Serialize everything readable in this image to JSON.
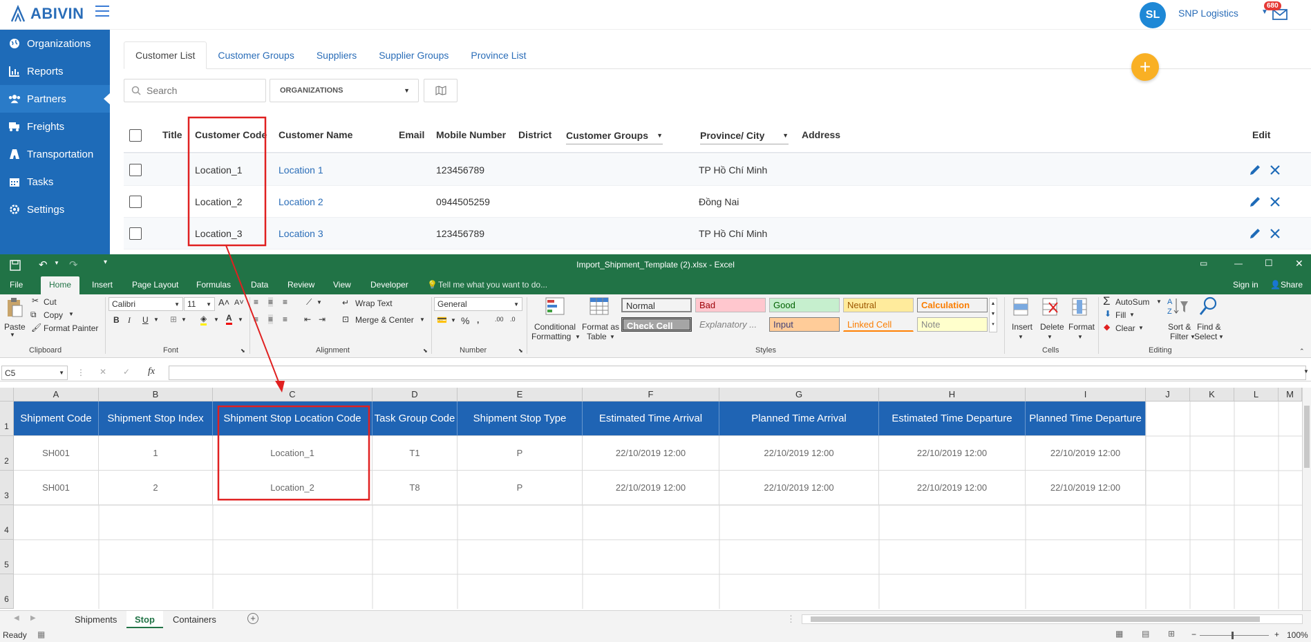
{
  "app": {
    "logo_text": "ABIVIN",
    "avatar_initials": "SL",
    "company": "SNP Logistics",
    "notification_count": "680",
    "brand_color": "#1e6bb8",
    "sidebar": [
      {
        "label": "Organizations",
        "icon": "globe-icon"
      },
      {
        "label": "Reports",
        "icon": "bar-chart-icon"
      },
      {
        "label": "Partners",
        "icon": "users-icon",
        "active": true
      },
      {
        "label": "Freights",
        "icon": "truck-icon"
      },
      {
        "label": "Transportation",
        "icon": "road-icon"
      },
      {
        "label": "Tasks",
        "icon": "calendar-icon"
      },
      {
        "label": "Settings",
        "icon": "gear-icon"
      }
    ],
    "tabs": [
      "Customer List",
      "Customer Groups",
      "Suppliers",
      "Supplier Groups",
      "Province List"
    ],
    "search_placeholder": "Search",
    "org_select": "ORGANIZATIONS",
    "columns": {
      "title": "Title",
      "customer_code": "Customer Code",
      "customer_name": "Customer Name",
      "email": "Email",
      "mobile": "Mobile Number",
      "district": "District",
      "customer_groups": "Customer Groups",
      "province": "Province/ City",
      "address": "Address",
      "edit": "Edit"
    },
    "rows": [
      {
        "code": "Location_1",
        "name": "Location 1",
        "mobile": "123456789",
        "province": "TP Hồ Chí Minh"
      },
      {
        "code": "Location_2",
        "name": "Location 2",
        "mobile": "0944505259",
        "province": "Đồng Nai"
      },
      {
        "code": "Location_3",
        "name": "Location 3",
        "mobile": "123456789",
        "province": "TP Hồ Chí Minh"
      }
    ]
  },
  "excel": {
    "title": "Import_Shipment_Template (2).xlsx - Excel",
    "accent": "#217346",
    "menu": [
      "File",
      "Home",
      "Insert",
      "Page Layout",
      "Formulas",
      "Data",
      "Review",
      "View",
      "Developer"
    ],
    "tell_me": "Tell me what you want to do...",
    "sign_in": "Sign in",
    "share": "Share",
    "ribbon": {
      "paste": "Paste",
      "cut": "Cut",
      "copy": "Copy",
      "format_painter": "Format Painter",
      "clipboard": "Clipboard",
      "font_name": "Calibri",
      "font_size": "11",
      "font": "Font",
      "wrap_text": "Wrap Text",
      "merge_center": "Merge & Center",
      "alignment": "Alignment",
      "number_format": "General",
      "number": "Number",
      "conditional": "Conditional",
      "formatting": "Formatting",
      "format_as": "Format as",
      "table": "Table",
      "styles_label": "Styles",
      "styles": [
        {
          "label": "Normal",
          "bg": "#ffffff",
          "fg": "#888888"
        },
        {
          "label": "Bad",
          "bg": "#ffc7ce",
          "fg": "#9c0006"
        },
        {
          "label": "Good",
          "bg": "#c6efce",
          "fg": "#006100"
        },
        {
          "label": "Neutral",
          "bg": "#ffeb9c",
          "fg": "#9c5700"
        },
        {
          "label": "Calculation",
          "bg": "#f2f2f2",
          "fg": "#fa7d00"
        },
        {
          "label": "Check Cell",
          "bg": "#a5a5a5",
          "fg": "#ffffff"
        },
        {
          "label": "Explanatory ...",
          "bg": "#ffffff",
          "fg": "#7f7f7f"
        },
        {
          "label": "Input",
          "bg": "#ffcc99",
          "fg": "#3f3f76"
        },
        {
          "label": "Linked Cell",
          "bg": "#ffffff",
          "fg": "#fa7d00"
        },
        {
          "label": "Note",
          "bg": "#ffffcc",
          "fg": "#888888"
        }
      ],
      "insert": "Insert",
      "delete": "Delete",
      "format": "Format",
      "cells": "Cells",
      "autosum": "AutoSum",
      "fill": "Fill",
      "clear": "Clear",
      "sort_filter": "Sort &",
      "filter": "Filter",
      "find_select": "Find &",
      "select": "Select",
      "editing": "Editing"
    },
    "name_box": "C5",
    "fx": "fx",
    "col_letters": [
      "A",
      "B",
      "C",
      "D",
      "E",
      "F",
      "G",
      "H",
      "I",
      "J",
      "K",
      "L",
      "M"
    ],
    "row_numbers": [
      "1",
      "2",
      "3",
      "4",
      "5",
      "6"
    ],
    "headers": [
      "Shipment Code",
      "Shipment Stop Index",
      "Shipment Stop Location Code",
      "Task Group Code",
      "Shipment Stop Type",
      "Estimated Time Arrival",
      "Planned Time Arrival",
      "Estimated Time Departure",
      "Planned Time Departure"
    ],
    "data_rows": [
      [
        "SH001",
        "1",
        "Location_1",
        "T1",
        "P",
        "22/10/2019 12:00",
        "22/10/2019 12:00",
        "22/10/2019 12:00",
        "22/10/2019 12:00"
      ],
      [
        "SH001",
        "2",
        "Location_2",
        "T8",
        "P",
        "22/10/2019 12:00",
        "22/10/2019 12:00",
        "22/10/2019 12:00",
        "22/10/2019 12:00"
      ]
    ],
    "sheets": [
      "Shipments",
      "Stop",
      "Containers"
    ],
    "active_sheet": "Stop",
    "status": "Ready",
    "zoom": "100%"
  },
  "annotation_color": "#e02020"
}
